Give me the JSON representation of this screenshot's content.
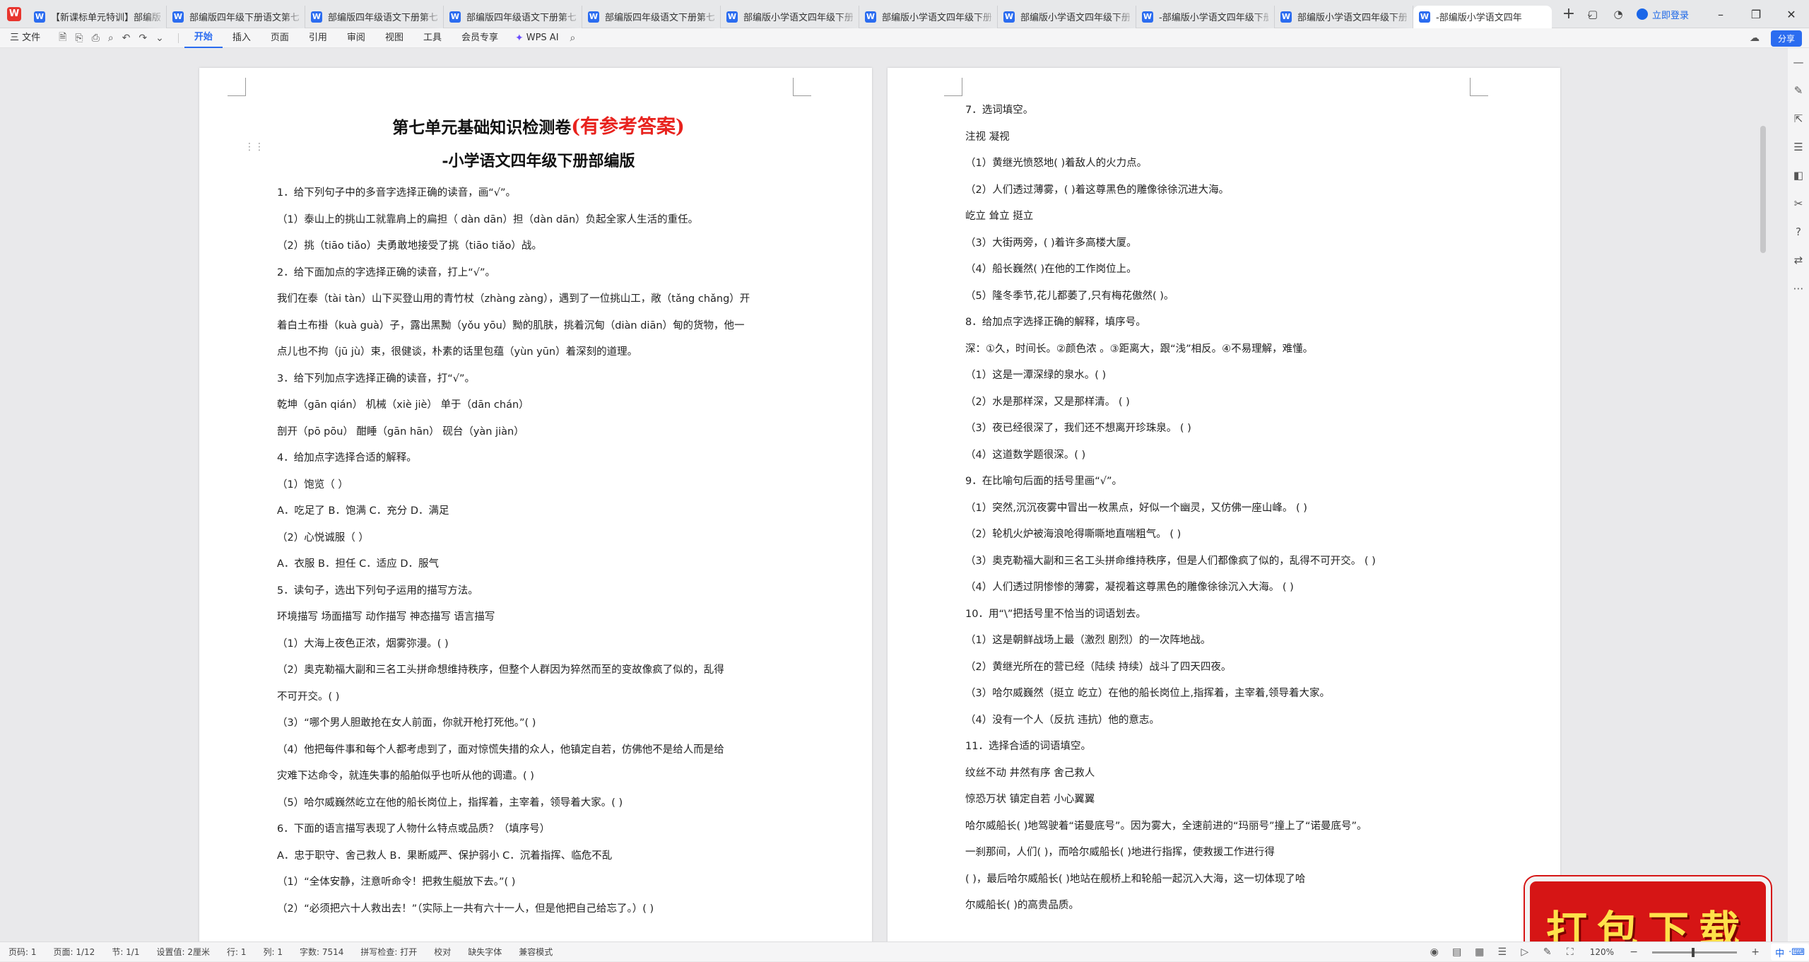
{
  "tabs": [
    {
      "label": "【新课标单元特训】部编版",
      "active": false
    },
    {
      "label": "部编版四年级下册语文第七单元",
      "active": false
    },
    {
      "label": "部编版四年级语文下册第七单元",
      "active": false
    },
    {
      "label": "部编版四年级语文下册第七单元",
      "active": false
    },
    {
      "label": "部编版四年级语文下册第七单元",
      "active": false
    },
    {
      "label": "部编版小学语文四年级下册",
      "active": false
    },
    {
      "label": "部编版小学语文四年级下册",
      "active": false
    },
    {
      "label": "部编版小学语文四年级下册",
      "active": false
    },
    {
      "label": "-部编版小学语文四年级下册",
      "active": false
    },
    {
      "label": "部编版小学语文四年级下册",
      "active": false
    },
    {
      "label": "-部编版小学语文四年",
      "active": true
    }
  ],
  "titlebar": {
    "login": "立即登录",
    "share": "分享"
  },
  "menu": {
    "file": "三 文件",
    "items": [
      "开始",
      "插入",
      "页面",
      "引用",
      "审阅",
      "视图",
      "工具",
      "会员专享"
    ],
    "active": "开始",
    "ai": "WPS AI"
  },
  "doc": {
    "title_main": "第七单元基础知识检测卷",
    "title_note": "(有参考答案)",
    "subtitle": "-小学语文四年级下册部编版",
    "page1_lines": [
      "1．给下列句子中的多音字选择正确的读音，画“√”。",
      "（1）泰山上的挑山工就靠肩上的扁担（ dàn dān）担（dàn dān）负起全家人生活的重任。",
      "（2）挑（tiāo tiǎo）夫勇敢地接受了挑（tiāo tiǎo）战。",
      "2．给下面加点的字选择正确的读音，打上“√”。",
      "我们在泰（tài tàn）山下买登山用的青竹杖（zhàng zàng），遇到了一位挑山工，敞（tǎng chǎng）开",
      "着白土布褂（kuà guà）子，露出黑黝（yǒu yōu）黝的肌肤，挑着沉甸（diàn diān）甸的货物，他一",
      "点儿也不拘（jū jù）束，很健谈，朴素的话里包蕴（yùn yūn）着深刻的道理。",
      "3．给下列加点字选择正确的读音，打“√”。",
      "乾坤（gān qián）   机械（xiè jiè）    单于（dān chán）",
      "剖开（pō pōu）     酣睡（gān hān）    砚台（yàn jiàn）",
      "4．给加点字选择合适的解释。",
      "（1）饱览（        ）",
      "A．吃足了  B．饱满  C．充分  D．满足",
      "（2）心悦诚服（        ）",
      "A．衣服    B．担任  C．适应  D．服气",
      "5．读句子，选出下列句子运用的描写方法。",
      "环境描写  场面描写  动作描写  神态描写  语言描写",
      "（1）大海上夜色正浓，烟雾弥漫。(          )",
      "（2）奥克勒福大副和三名工头拼命想维持秩序，但整个人群因为猝然而至的变故像疯了似的，乱得",
      "不可开交。(          )",
      "（3）“哪个男人胆敢抢在女人前面，你就开枪打死他。”(          )",
      "（4）他把每件事和每个人都考虑到了，面对惊慌失措的众人，他镇定自若，仿佛他不是给人而是给",
      "灾难下达命令，就连失事的船舶似乎也听从他的调遣。(          )",
      "（5）哈尔威巍然屹立在他的船长岗位上，指挥着，主宰着，领导着大家。(          )",
      "6．下面的语言描写表现了人物什么特点或品质？（填序号）",
      "A．忠于职守、舍己救人   B．果断威严、保护弱小   C．沉着指挥、临危不乱",
      "（1）“全体安静，注意听命令！把救生艇放下去。”(      )",
      "（2）“必须把六十人救出去！”（实际上一共有六十一人，但是他把自己给忘了。）(      )"
    ],
    "page2_lines": [
      "7．选词填空。",
      "注视      凝视",
      "（1）黄继光愤怒地(          )着敌人的火力点。",
      "（2）人们透过薄雾，(          )着这尊黑色的雕像徐徐沉进大海。",
      "屹立      耸立      挺立",
      "（3）大街两旁，(          )着许多高楼大厦。",
      "（4）船长巍然(          )在他的工作岗位上。",
      "（5）隆冬季节,花儿都萎了,只有梅花傲然(        )。",
      "8．给加点字选择正确的解释，填序号。",
      "深：①久，时间长。②颜色浓 。③距离大，跟“浅”相反。④不易理解，难懂。",
      "（1）这是一潭深绿的泉水。(          )",
      "（2）水是那样深，又是那样清。 (          )",
      "（3）夜已经很深了，我们还不想离开珍珠泉。 (          )",
      "（4）这道数学题很深。(          )",
      "9．在比喻句后面的括号里画“√”。",
      "（1）突然,沉沉夜雾中冒出一枚黑点，好似一个幽灵，又仿佛一座山峰。 (          )",
      "（2）轮机火炉被海浪呛得嘶嘶地直喘粗气。 (          )",
      "（3）奥克勒福大副和三名工头拼命维持秩序，但是人们都像疯了似的，乱得不可开交。 (          )",
      "（4）人们透过阴惨惨的薄雾，凝视着这尊黑色的雕像徐徐沉入大海。 (          )",
      "10．用“\\”把括号里不恰当的词语划去。",
      "（1）这是朝鲜战场上最（激烈  剧烈）的一次阵地战。",
      "（2）黄继光所在的营已经（陆续  持续）战斗了四天四夜。",
      "（3）哈尔威巍然（挺立  屹立）在他的船长岗位上,指挥着，主宰着,领导着大家。",
      "（4）没有一个人（反抗  违抗）他的意志。",
      "11．选择合适的词语填空。",
      "纹丝不动    井然有序    舍己救人",
      "惊恐万状    镇定自若    小心翼翼",
      "哈尔威船长(              )地驾驶着“诺曼底号”。因为雾大，全速前进的“玛丽号”撞上了“诺曼底号”。",
      "一刹那间，人们(              )，而哈尔威船长(              )地进行指挥，使救援工作进行得",
      "(              )，最后哈尔威船长(              )地站在舰桥上和轮船一起沉入大海，这一切体现了哈",
      "尔威船长(              )的高贵品质。"
    ]
  },
  "banner": "打包下载",
  "status": {
    "page": "页码: 1",
    "pages": "页面: 1/12",
    "section": "节: 1/1",
    "setting": "设置值: 2厘米",
    "row": "行: 1",
    "col": "列: 1",
    "words": "字数: 7514",
    "spell": "拼写检查: 打开",
    "proof": "校对",
    "font_missing": "缺失字体",
    "compat": "兼容模式",
    "zoom": "120%",
    "ime": "中"
  }
}
